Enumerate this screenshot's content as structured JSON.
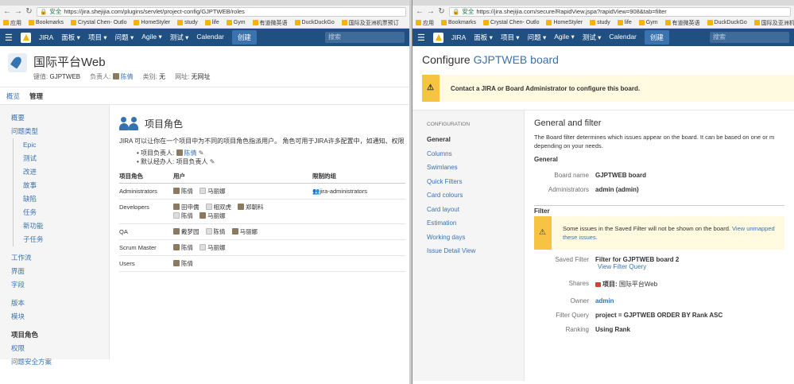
{
  "left": {
    "url": "https://jira.shejijia.com/plugins/servlet/project-config/GJPTWEB/roles",
    "secure": "安全",
    "bookmarks": [
      "应用",
      "Bookmarks",
      "Crystal Chen- Outlo",
      "HomeStyler",
      "study",
      "life",
      "Gym",
      "有道微英语",
      "DuckDuckGo",
      "国际及亚洲机票预订"
    ],
    "nav": {
      "logo": "JIRA",
      "items": [
        "面板 ▾",
        "项目 ▾",
        "问题 ▾",
        "Agile ▾",
        "测试 ▾",
        "Calendar"
      ],
      "create": "创建",
      "search": "搜索"
    },
    "project": {
      "name": "国际平台Web",
      "key_label": "键值:",
      "key": "GJPTWEB",
      "lead_label": "负责人:",
      "lead": "陈倩",
      "cat_label": "类别:",
      "cat": "无",
      "url_label": "网址:",
      "url": "无网址"
    },
    "tabs": [
      "概览",
      "管理"
    ],
    "sidebar": [
      "概要",
      "问题类型",
      "Epic",
      "测试",
      "改进",
      "故事",
      "缺陷",
      "任务",
      "新功能",
      "子任务",
      "工作流",
      "界面",
      "字段",
      "版本",
      "模块",
      "项目角色",
      "权限",
      "问题安全方案"
    ],
    "roles": {
      "title": "项目角色",
      "desc": "JIRA 可以让你在一个项目中为不同的项目角色指派用户。 角色可用于JIRA许多配置中，如通知、权限",
      "lead_line": "项目负责人:",
      "lead_name": "陈倩",
      "default_line": "默认经办人: 项目负责人",
      "headers": [
        "项目角色",
        "用户",
        "限制的组"
      ],
      "rows": [
        {
          "role": "Administrators",
          "users": [
            "陈倩",
            "马丽娜"
          ],
          "group": "jira-administrators"
        },
        {
          "role": "Developers",
          "users": [
            "田申儒",
            "相双虎",
            "郑朝科",
            "陈倩",
            "马丽娜"
          ],
          "group": ""
        },
        {
          "role": "QA",
          "users": [
            "戴梦园",
            "陈倩",
            "马丽娜"
          ],
          "group": ""
        },
        {
          "role": "Scrum Master",
          "users": [
            "陈倩",
            "马丽娜"
          ],
          "group": ""
        },
        {
          "role": "Users",
          "users": [
            "陈倩"
          ],
          "group": ""
        }
      ]
    }
  },
  "right": {
    "url": "https://jira.shejijia.com/secure/RapidView.jspa?rapidView=908&tab=filter",
    "secure": "安全",
    "bookmarks": [
      "应用",
      "Bookmarks",
      "Crystal Chen- Outlo",
      "HomeStyler",
      "study",
      "life",
      "Gym",
      "有道微英语",
      "DuckDuckGo",
      "国际及亚洲机票预"
    ],
    "nav": {
      "logo": "JIRA",
      "items": [
        "面板 ▾",
        "项目 ▾",
        "问题 ▾",
        "Agile ▾",
        "测试 ▾",
        "Calendar"
      ],
      "create": "创建",
      "search": "搜索"
    },
    "title_pre": "Configure ",
    "title_link": "GJPTWEB board",
    "warning": "Contact a JIRA or Board Administrator to configure this board.",
    "sidebar_head": "CONFIGURATION",
    "sidebar": [
      "General",
      "Columns",
      "Swimlanes",
      "Quick Filters",
      "Card colours",
      "Card layout",
      "Estimation",
      "Working days",
      "Issue Detail View"
    ],
    "general": {
      "title": "General and filter",
      "desc1": "The Board filter determines which issues appear on the board. It can be based on one or m",
      "desc2": "depending on your needs.",
      "section": "General",
      "board_name_label": "Board name",
      "board_name": "GJPTWEB board",
      "admins_label": "Administrators",
      "admins": "admin (admin)",
      "filter_section": "Filter",
      "filter_warn": "Some issues in the Saved Filter will not be shown on the board. ",
      "filter_warn_link": "View unmapped",
      "filter_warn_link2": "these issues.",
      "saved_label": "Saved Filter",
      "saved": "Filter for GJPTWEB board 2",
      "view_query": "View Filter Query",
      "shares_label": "Shares",
      "shares_pre": "项目:",
      "shares": "国际平台Web",
      "owner_label": "Owner",
      "owner": "admin",
      "query_label": "Filter Query",
      "query": "project = GJPTWEB ORDER BY Rank ASC",
      "ranking_label": "Ranking",
      "ranking": "Using Rank"
    }
  }
}
